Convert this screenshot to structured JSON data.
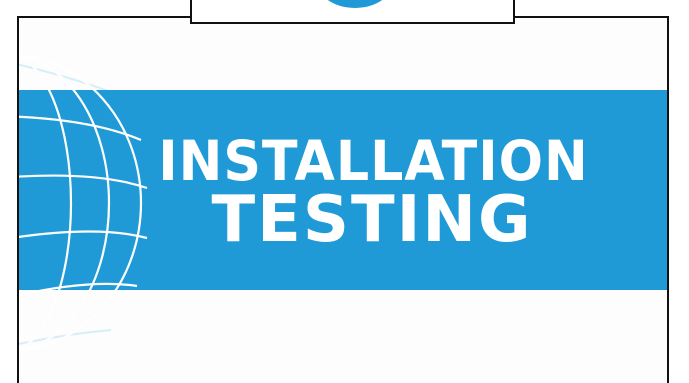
{
  "slide": {
    "title_line1": "INSTALLATION",
    "title_line2": "TESTING"
  },
  "colors": {
    "band": "#1f9ad6",
    "title_text": "#ffffff",
    "border": "#111111",
    "globe_lines": "#d7eef7",
    "tab_arc": "#1f9ad6"
  },
  "icons": {
    "globe": "globe-icon",
    "tab_logo_arc": "logo-arc-icon"
  }
}
